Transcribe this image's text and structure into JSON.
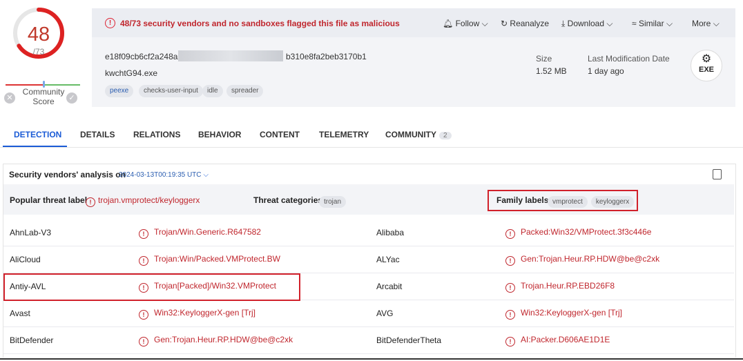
{
  "score": {
    "detected": "48",
    "total": "/73",
    "community_label": "Community Score"
  },
  "alert": {
    "text": "48/73 security vendors and no sandboxes flagged this file as malicious"
  },
  "actions": {
    "follow": "Follow",
    "reanalyze": "Reanalyze",
    "download": "Download",
    "similar": "Similar",
    "more": "More"
  },
  "file": {
    "hash_prefix": "e18f09cb6cf2a248a",
    "hash_suffix": "b310e8fa2beb3170b1",
    "name": "kwchtG94.exe",
    "tags": [
      "peexe",
      "checks-user-input",
      "idle",
      "spreader"
    ],
    "size_label": "Size",
    "size_value": "1.52 MB",
    "lastmod_label": "Last Modification Date",
    "lastmod_value": "1 day ago",
    "type_badge": "EXE"
  },
  "tabs": [
    {
      "label": "DETECTION"
    },
    {
      "label": "DETAILS"
    },
    {
      "label": "RELATIONS"
    },
    {
      "label": "BEHAVIOR"
    },
    {
      "label": "CONTENT"
    },
    {
      "label": "TELEMETRY"
    },
    {
      "label": "COMMUNITY",
      "count": "2"
    }
  ],
  "analysis": {
    "title": "Security vendors' analysis on",
    "date": "2024-03-13T00:19:35 UTC",
    "popular_label": "Popular threat label",
    "popular_value": "trojan.vmprotect/keyloggerx",
    "categories_label": "Threat categories",
    "categories": [
      "trojan"
    ],
    "family_label": "Family labels",
    "families": [
      "vmprotect",
      "keyloggerx"
    ]
  },
  "vendors": [
    {
      "left": "AhnLab-V3",
      "left_det": "Trojan/Win.Generic.R647582",
      "right": "Alibaba",
      "right_det": "Packed:Win32/VMProtect.3f3c446e"
    },
    {
      "left": "AliCloud",
      "left_det": "Trojan:Win/Packed.VMProtect.BW",
      "right": "ALYac",
      "right_det": "Gen:Trojan.Heur.RP.HDW@be@c2xk"
    },
    {
      "left": "Antiy-AVL",
      "left_det": "Trojan[Packed]/Win32.VMProtect",
      "right": "Arcabit",
      "right_det": "Trojan.Heur.RP.EBD26F8"
    },
    {
      "left": "Avast",
      "left_det": "Win32:KeyloggerX-gen [Trj]",
      "right": "AVG",
      "right_det": "Win32:KeyloggerX-gen [Trj]"
    },
    {
      "left": "BitDefender",
      "left_det": "Gen:Trojan.Heur.RP.HDW@be@c2xk",
      "right": "BitDefenderTheta",
      "right_det": "AI:Packer.D606AE1D1E"
    }
  ],
  "colors": {
    "accent": "#1a5bd6",
    "malicious": "#c0262d"
  }
}
